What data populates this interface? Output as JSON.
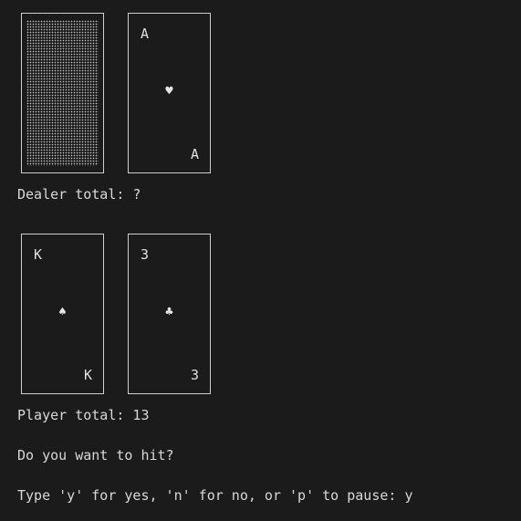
{
  "dealer": {
    "cards": [
      {
        "face_down": true
      },
      {
        "rank": "A",
        "suit": "♥",
        "suit_name": "hearts"
      }
    ],
    "total_label": "Dealer total: ?"
  },
  "player": {
    "cards": [
      {
        "rank": "K",
        "suit": "♠",
        "suit_name": "spades"
      },
      {
        "rank": "3",
        "suit": "♣",
        "suit_name": "clubs"
      }
    ],
    "total_label": "Player total: 13"
  },
  "prompt": {
    "question": "Do you want to hit?",
    "instruction": "Type 'y' for yes, 'n' for no, or 'p' to pause: y"
  },
  "colors": {
    "background": "#1b1b1b",
    "text": "#d8d8d8",
    "card_border": "#cfcfcf"
  }
}
